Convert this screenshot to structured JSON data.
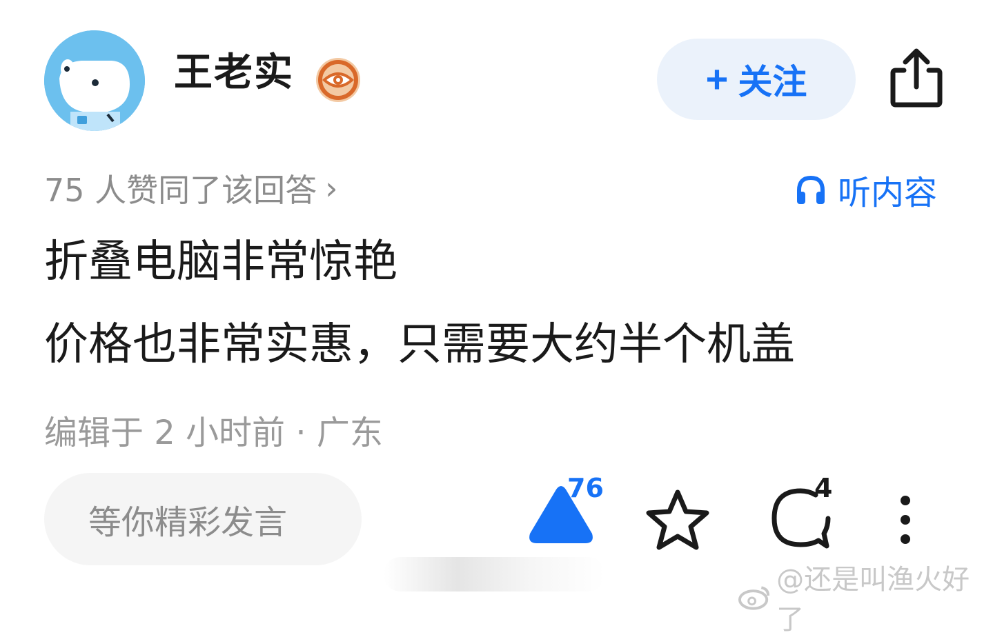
{
  "author": {
    "name": "王老实",
    "badge_icon": "eye-badge-icon",
    "avatar_icon": "dog-astronaut-avatar"
  },
  "header": {
    "follow_plus": "+",
    "follow_label": "关注",
    "share_icon": "share-icon"
  },
  "meta": {
    "upvote_summary": "75 人赞同了该回答",
    "upvote_arrow": "›",
    "listen_label": "听内容",
    "listen_icon": "headphones-icon"
  },
  "content": {
    "lines": [
      "折叠电脑非常惊艳",
      "价格也非常实惠，只需要大约半个机盖"
    ]
  },
  "edit_meta": "编辑于 2 小时前 · 广东",
  "actions": {
    "comment_placeholder": "等你精彩发言",
    "upvote_count": "76",
    "comment_count": "4",
    "more_icon": "more-vertical-icon"
  },
  "watermark": "@还是叫渔火好了",
  "colors": {
    "accent": "#1772f6",
    "follow_bg": "#ebf2fb",
    "muted_text": "#8c8c8c",
    "input_bg": "#f5f5f5"
  }
}
